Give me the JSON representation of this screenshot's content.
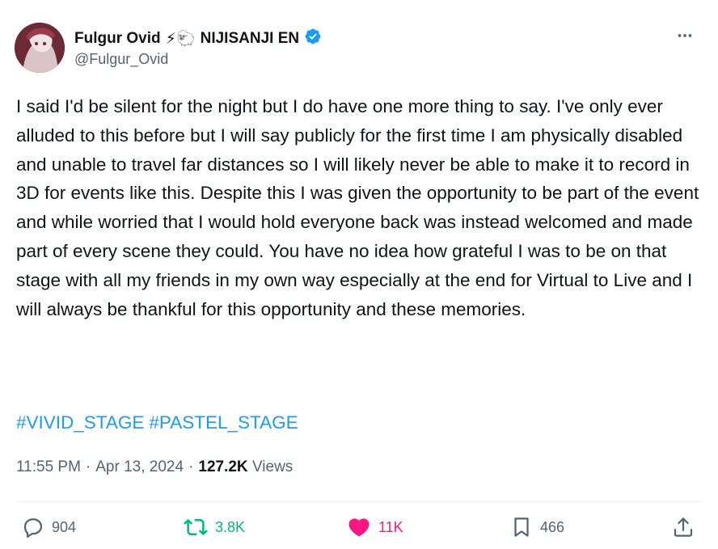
{
  "author": {
    "display_name": "Fulgur Ovid",
    "emojis": "⚡🐑",
    "affiliation": "NIJISANJI EN",
    "handle": "@Fulgur_Ovid",
    "verified_color": "#1d9bf0"
  },
  "tweet": {
    "text": "I said I'd be silent for the night but I do have one more thing to say. I've only ever alluded to this before but I will say publicly for the first time I am physically disabled and unable to travel far distances so I will likely never be able to make it to record in 3D for events like this. Despite this I was given the opportunity to be part of the event and while worried that I would hold everyone back was instead welcomed and made part of every scene they could. You have no idea how grateful I was to be on that stage with all my friends in my own way especially at the end for Virtual to Live and I will always be thankful for this opportunity and these memories.",
    "hashtags": [
      "#VIVID_STAGE",
      "#PASTEL_STAGE"
    ]
  },
  "meta": {
    "time": "11:55 PM",
    "sep1": "·",
    "date": "Apr 13, 2024",
    "sep2": "·",
    "views_count": "127.2K",
    "views_label": "Views"
  },
  "actions": {
    "replies": "904",
    "reposts": "3.8K",
    "likes": "11K",
    "bookmarks": "466"
  },
  "colors": {
    "text": "#0f1419",
    "secondary": "#536471",
    "link": "#1d9bf0",
    "repost": "#00ba7c",
    "like": "#f91880"
  }
}
